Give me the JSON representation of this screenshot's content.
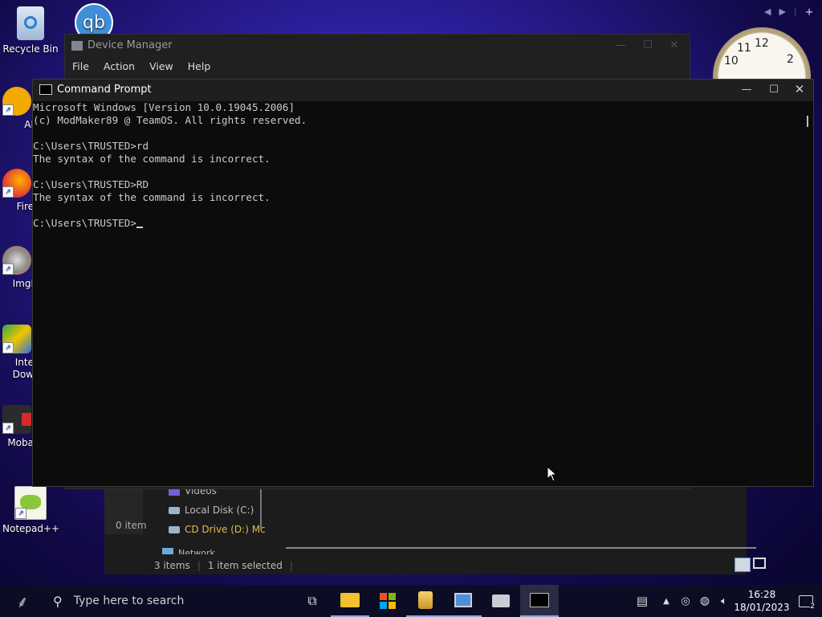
{
  "desktop": {
    "icons": [
      {
        "label": "Recycle Bin"
      },
      {
        "label": "AI"
      },
      {
        "label": "Fire"
      },
      {
        "label": "ImgI"
      },
      {
        "label": "Inte\nDow"
      },
      {
        "label": "Moba"
      },
      {
        "label": "Notepad++"
      }
    ],
    "qb_text": "qb",
    "clock": {
      "n12": "12",
      "n11": "11",
      "n10": "10",
      "n2": "2"
    }
  },
  "device_manager": {
    "title": "Device Manager",
    "menu": [
      "File",
      "Action",
      "View",
      "Help"
    ]
  },
  "explorer": {
    "nav": [
      "Videos",
      "Local Disk (C:)",
      "CD Drive (D:) Mc",
      "Network"
    ],
    "left_status": "0 item",
    "status_items": "3 items",
    "status_selected": "1 item selected"
  },
  "cmd": {
    "title": "Command Prompt",
    "lines": [
      "Microsoft Windows [Version 10.0.19045.2006]",
      "(c) ModMaker89 @ TeamOS. All rights reserved.",
      "",
      "C:\\Users\\TRUSTED>rd",
      "The syntax of the command is incorrect.",
      "",
      "C:\\Users\\TRUSTED>RD",
      "The syntax of the command is incorrect.",
      ""
    ],
    "prompt": "C:\\Users\\TRUSTED>"
  },
  "taskbar": {
    "search_placeholder": "Type here to search",
    "time": "16:28",
    "date": "18/01/2023",
    "notification_count": "2"
  },
  "colors": {
    "accent": "#0078d4",
    "console_bg": "#0c0c0c",
    "console_fg": "#cccccc"
  }
}
